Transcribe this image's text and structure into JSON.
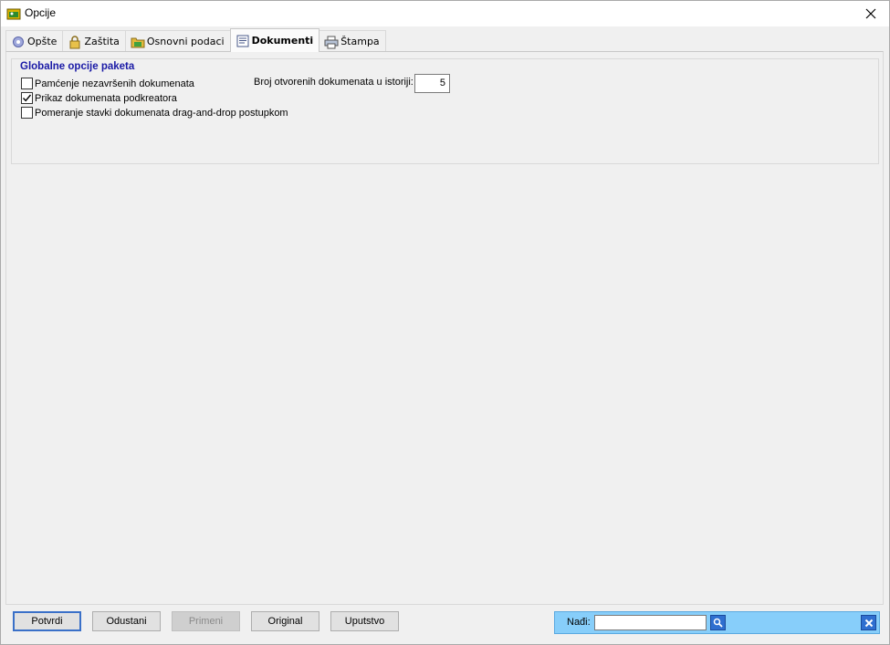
{
  "window": {
    "title": "Opcije"
  },
  "tabs": [
    {
      "label": "Opšte",
      "icon": "gear-icon"
    },
    {
      "label": "Zaštita",
      "icon": "lock-icon"
    },
    {
      "label": "Osnovni podaci",
      "icon": "folder-icon"
    },
    {
      "label": "Dokumenti",
      "icon": "document-icon",
      "active": true
    },
    {
      "label": "Štampa",
      "icon": "printer-icon"
    }
  ],
  "group": {
    "title": "Globalne opcije paketa",
    "options": [
      {
        "label": "Pamćenje nezavršenih dokumenata",
        "checked": false
      },
      {
        "label": "Prikaz dokumenata podkreatora",
        "checked": true
      },
      {
        "label": "Pomeranje stavki dokumenata drag-and-drop postupkom",
        "checked": false
      }
    ],
    "history_label": "Broj otvorenih dokumenata u istoriji:",
    "history_value": "5"
  },
  "buttons": {
    "confirm": "Potvrdi",
    "cancel": "Odustani",
    "apply": "Primeni",
    "original": "Original",
    "help": "Uputstvo"
  },
  "search": {
    "label": "Nađi:",
    "value": ""
  },
  "colors": {
    "accent": "#1a1aa6",
    "search_bar": "#87cefa"
  }
}
